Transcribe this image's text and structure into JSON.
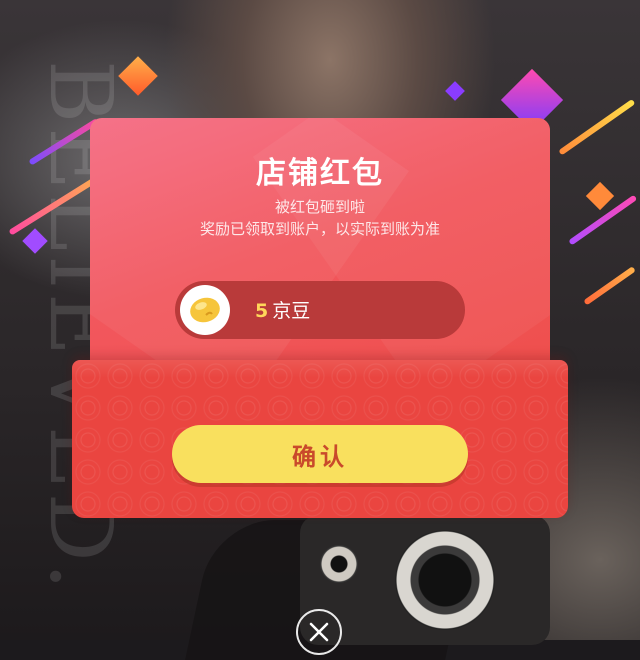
{
  "dialog": {
    "title": "店铺红包",
    "subtitle_line1": "被红包砸到啦",
    "subtitle_line2": "奖励已领取到账户，以实际到账为准",
    "reward": {
      "amount": "5",
      "unit": "京豆",
      "icon": "jingdou-bean-icon"
    },
    "confirm_label": "确认",
    "close_icon": "close-icon"
  },
  "background": {
    "watermark_text": "BELIEVED.",
    "colors": {
      "card": "#f2575d",
      "pocket": "#ea4540",
      "button": "#f9e05e",
      "button_text": "#c94a2b"
    }
  }
}
